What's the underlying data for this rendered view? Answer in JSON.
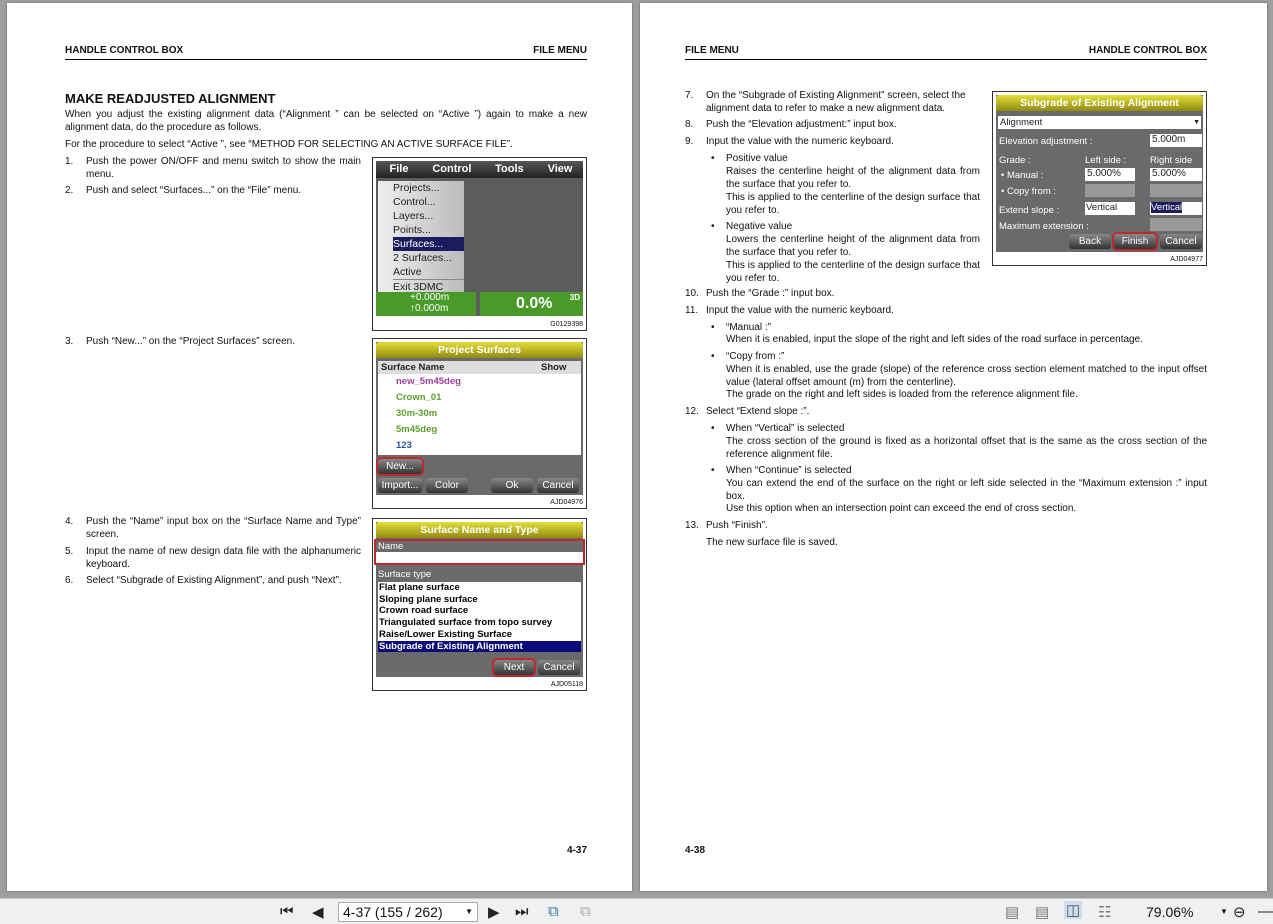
{
  "left_page": {
    "header_left": "HANDLE CONTROL BOX",
    "header_right": "FILE MENU",
    "title": "MAKE READJUSTED ALIGNMENT",
    "intro": "When you adjust the existing alignment data (“Alignment ” can be selected on “Active ”) again to make a new alignment data, do the procedure as follows.",
    "intro2": "For the procedure to select “Active ”, see “METHOD FOR SELECTING AN ACTIVE SURFACE FILE”.",
    "steps": [
      {
        "n": "1.",
        "text": "Push the power ON/OFF and menu switch to show the main menu."
      },
      {
        "n": "2.",
        "text": "Push and select “Surfaces...” on the “File” menu."
      },
      {
        "n": "3.",
        "text": "Push “New...” on the “Project Surfaces” screen."
      },
      {
        "n": "4.",
        "text": "Push the “Name” input box on the “Surface Name and Type” screen."
      },
      {
        "n": "5.",
        "text": "Input the name of new design data file with the alphanumeric keyboard."
      },
      {
        "n": "6.",
        "text": "Select “Subgrade of Existing Alignment”, and push “Next”."
      }
    ],
    "page_number": "4-37",
    "fig1": {
      "id": "G0129398",
      "menus": [
        "File",
        "Control",
        "Tools",
        "View"
      ],
      "items": [
        "Projects...",
        "Control...",
        "Layers...",
        "Points...",
        "Surfaces...",
        "2 Surfaces...",
        "Active",
        "Exit 3DMC"
      ],
      "value1": "+0.000m",
      "value2": "↑0.000m",
      "percent": "0.0%",
      "mode": "3D"
    },
    "fig2": {
      "id": "AJD04976",
      "title": "Project Surfaces",
      "col_name": "Surface Name",
      "col_show": "Show",
      "rows": [
        "new_5m45deg",
        "Crown_01",
        "30m-30m",
        "5m45deg",
        "123"
      ],
      "row_colors": [
        "#a0409a",
        "#5aa02a",
        "#5aa02a",
        "#5aa02a",
        "#2a50a0"
      ],
      "new": "New...",
      "import": "Import...",
      "color": "Color",
      "ok": "Ok",
      "cancel": "Cancel"
    },
    "fig3": {
      "id": "AJD05118",
      "title": "Surface Name and Type",
      "name_label": "Name",
      "type_label": "Surface type",
      "types": [
        "Flat plane surface",
        "Sloping plane surface",
        "Crown road surface",
        "Triangulated surface from topo survey",
        "Raise/Lower Existing Surface",
        "Subgrade of Existing Alignment"
      ],
      "next": "Next",
      "cancel": "Cancel"
    }
  },
  "right_page": {
    "header_left": "FILE MENU",
    "header_right": "HANDLE CONTROL BOX",
    "s7": "On the “Subgrade of Existing Alignment” screen, select the alignment data to refer to make a new alignment data.",
    "s8": "Push the “Elevation adjustment:” input box.",
    "s9": "Input the value with the numeric keyboard.",
    "pos_t": "Positive value",
    "pos_1": "Raises the centerline height of the alignment data from the surface that you refer to.",
    "pos_2": "This is applied to the centerline of the design surface that you refer to.",
    "neg_t": "Negative value",
    "neg_1": "Lowers the centerline height of the alignment data from the surface that you refer to.",
    "neg_2": "This is applied to the centerline of the design surface that you refer to.",
    "s10": "Push the “Grade :” input box.",
    "s11": "Input the value with the numeric keyboard.",
    "man_t": "“Manual :”",
    "man_1": "When it is enabled, input the slope of the right and left sides of the road surface in percentage.",
    "copy_t": "“Copy from :”",
    "copy_1": "When it is enabled, use the grade (slope) of the reference cross section element matched to the input offset value (lateral offset amount (m) from the centerline).",
    "copy_2": "The grade on the right and left sides is loaded from the reference alignment file.",
    "s12": "Select “Extend slope :”.",
    "vert_t": "When “Vertical” is selected",
    "vert_1": "The cross section of the ground is fixed as a horizontal offset that is the same as the cross section of the reference alignment file.",
    "cont_t": "When “Continue” is selected",
    "cont_1": "You can extend the end of the surface on the right or left side selected in the “Maximum extension :” input box.",
    "cont_2": "Use this option when an intersection point can exceed the end of cross section.",
    "s13": "Push “Finish”.",
    "saved": "The new surface file is saved.",
    "nums": [
      "7.",
      "8.",
      "9.",
      "10.",
      "11.",
      "12.",
      "13."
    ],
    "page_number": "4-38",
    "fig4": {
      "id": "AJD04977",
      "title": "Subgrade of Existing Alignment",
      "alignment": "Alignment",
      "elev_label": "Elevation adjustment :",
      "elev": "5.000m",
      "grade": "Grade :",
      "left": "Left side :",
      "right": "Right side",
      "manual": "Manual :",
      "copy": "Copy from :",
      "manual_l": "5.000%",
      "manual_r": "5.000%",
      "extend": "Extend slope :",
      "ext_l": "Vertical",
      "ext_r": "Vertical",
      "maxext": "Maximum extension :",
      "back": "Back",
      "finish": "Finish",
      "cancel": "Cancel"
    }
  },
  "toolbar": {
    "page_field": "4-37 (155 / 262)",
    "zoom": "79.06%"
  }
}
